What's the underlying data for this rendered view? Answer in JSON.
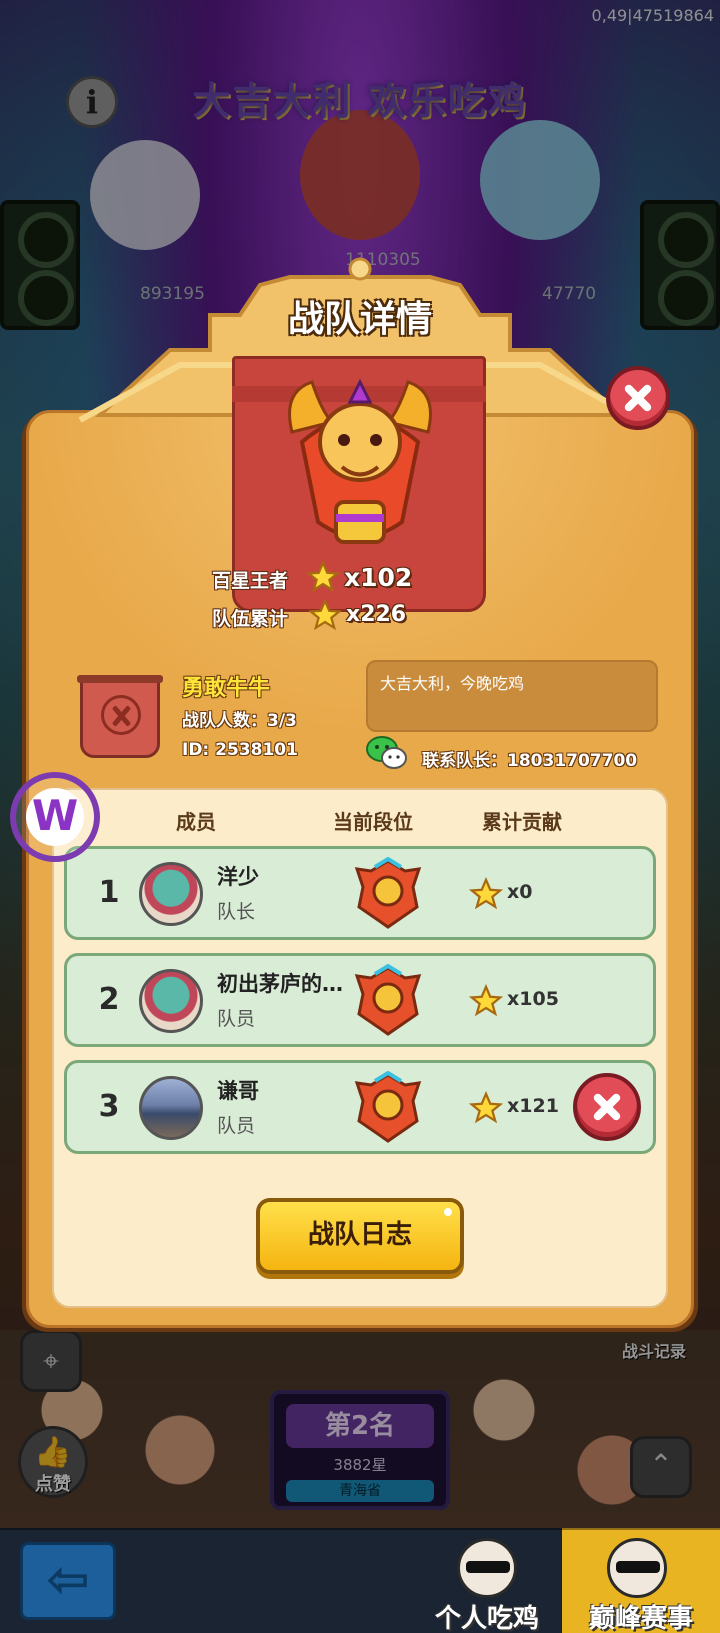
{
  "status": {
    "version": "0,49|47519864"
  },
  "background": {
    "title": "大吉大利 欢乐吃鸡",
    "info_icon": "info-icon",
    "scores": {
      "center": "1110305",
      "left": "893195",
      "right": "47770"
    },
    "rank_card": {
      "title": "第2名",
      "stars": "3882星",
      "province": "青海省"
    },
    "battle_log": "战斗记录",
    "like_label": "点赞"
  },
  "bottom_bar": {
    "tabs": [
      {
        "label": "个人吃鸡"
      },
      {
        "label": "巅峰赛事"
      }
    ]
  },
  "modal": {
    "title": "战队详情",
    "stats": {
      "hundred_star_label": "百星王者",
      "hundred_star_value": "x102",
      "team_total_label": "队伍累计",
      "team_total_value": "x226"
    },
    "team": {
      "name": "勇敢牛牛",
      "members_count": "战队人数：3/3",
      "id": "ID: 2538101",
      "motto": "大吉大利，今晚吃鸡",
      "contact": "联系队长：18031707700"
    },
    "columns": {
      "member": "成员",
      "rank": "当前段位",
      "contribution": "累计贡献"
    },
    "members": [
      {
        "num": "1",
        "name": "洋少",
        "role": "队长",
        "contribution": "x0"
      },
      {
        "num": "2",
        "name": "初出茅庐的…",
        "role": "队员",
        "contribution": "x105"
      },
      {
        "num": "3",
        "name": "谦哥",
        "role": "队员",
        "contribution": "x121"
      }
    ],
    "log_button": "战队日志"
  },
  "floating_logo": "W",
  "colors": {
    "modal_bg": "#e8a94a",
    "panel_bg": "#fdecc9",
    "row_bg": "#d9ecd6",
    "close_red": "#e24c56",
    "button_yellow": "#f5b411",
    "team_name_yellow": "#ffe53a"
  }
}
